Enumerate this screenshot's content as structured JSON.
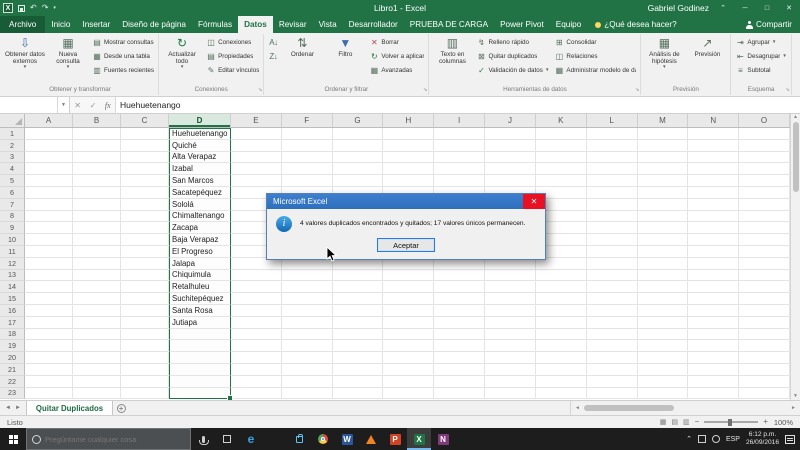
{
  "colors": {
    "excel_green": "#217346",
    "archivo_tab_green": "#185c37",
    "ribbon_bg": "#f1f1f1",
    "selection_green": "#217346",
    "dialog_title_blue": "#2d6fbd",
    "close_button_red": "#e81123",
    "info_icon_blue": "#1f87d4",
    "taskbar_dark": "#1d1d1d"
  },
  "title_bar": {
    "title": "Libro1 - Excel",
    "user_name": "Gabriel Godinez"
  },
  "ribbon": {
    "tabs": [
      "Archivo",
      "Inicio",
      "Insertar",
      "Diseño de página",
      "Fórmulas",
      "Datos",
      "Revisar",
      "Vista",
      "Desarrollador",
      "PRUEBA DE CARGA",
      "Power Pivot",
      "Equipo"
    ],
    "active_tab": "Datos",
    "tell_me": "¿Qué desea hacer?",
    "share_label": "Compartir",
    "groups": [
      {
        "label": "Obtener y transformar",
        "launcher": false,
        "buttons": [
          {
            "label": "Obtener datos externos",
            "type": "big",
            "icon": "external-data-icon",
            "dropdown": true
          },
          {
            "label": "Nueva consulta",
            "type": "big",
            "icon": "new-query-icon",
            "dropdown": true
          },
          {
            "label": "Mostrar consultas",
            "type": "small",
            "icon": "show-queries-icon",
            "dropdown": false
          },
          {
            "label": "Desde una tabla",
            "type": "small",
            "icon": "from-table-icon",
            "dropdown": false
          },
          {
            "label": "Fuentes recientes",
            "type": "small",
            "icon": "recent-sources-icon",
            "dropdown": false
          }
        ]
      },
      {
        "label": "Conexiones",
        "launcher": true,
        "buttons": [
          {
            "label": "Actualizar todo",
            "type": "big",
            "icon": "refresh-icon",
            "dropdown": true
          },
          {
            "label": "Conexiones",
            "type": "small",
            "icon": "connections-icon",
            "dropdown": false
          },
          {
            "label": "Propiedades",
            "type": "small",
            "icon": "properties-icon",
            "dropdown": false
          },
          {
            "label": "Editar vínculos",
            "type": "small",
            "icon": "edit-links-icon",
            "dropdown": false
          }
        ]
      },
      {
        "label": "Ordenar y filtrar",
        "launcher": true,
        "buttons": [
          {
            "label": "",
            "type": "small",
            "icon": "sort-az-icon",
            "dropdown": false
          },
          {
            "label": "",
            "type": "small",
            "icon": "sort-za-icon",
            "dropdown": false
          },
          {
            "label": "Ordenar",
            "type": "big",
            "icon": "sort-icon",
            "dropdown": false
          },
          {
            "label": "Filtro",
            "type": "big",
            "icon": "filter-icon",
            "dropdown": false
          },
          {
            "label": "Borrar",
            "type": "small",
            "icon": "clear-icon",
            "dropdown": false
          },
          {
            "label": "Volver a aplicar",
            "type": "small",
            "icon": "reapply-icon",
            "dropdown": false
          },
          {
            "label": "Avanzadas",
            "type": "small",
            "icon": "advanced-icon",
            "dropdown": false
          }
        ]
      },
      {
        "label": "Herramientas de datos",
        "launcher": true,
        "buttons": [
          {
            "label": "Texto en columnas",
            "type": "big",
            "icon": "text-to-columns-icon",
            "dropdown": false
          },
          {
            "label": "Relleno rápido",
            "type": "small",
            "icon": "flash-fill-icon",
            "dropdown": false
          },
          {
            "label": "Quitar duplicados",
            "type": "small",
            "icon": "remove-duplicates-icon",
            "dropdown": false
          },
          {
            "label": "Validación de datos",
            "type": "small",
            "icon": "data-validation-icon",
            "dropdown": true
          },
          {
            "label": "Consolidar",
            "type": "small",
            "icon": "consolidate-icon",
            "dropdown": false
          },
          {
            "label": "Relaciones",
            "type": "small",
            "icon": "relationships-icon",
            "dropdown": false
          },
          {
            "label": "Administrar modelo de datos",
            "type": "small",
            "icon": "data-model-icon",
            "dropdown": false
          }
        ]
      },
      {
        "label": "Previsión",
        "launcher": false,
        "buttons": [
          {
            "label": "Análisis de hipótesis",
            "type": "big",
            "icon": "what-if-icon",
            "dropdown": true
          },
          {
            "label": "Previsión",
            "type": "big",
            "icon": "forecast-icon",
            "dropdown": false
          }
        ]
      },
      {
        "label": "Esquema",
        "launcher": true,
        "buttons": [
          {
            "label": "Agrupar",
            "type": "small",
            "icon": "group-icon",
            "dropdown": true
          },
          {
            "label": "Desagrupar",
            "type": "small",
            "icon": "ungroup-icon",
            "dropdown": true
          },
          {
            "label": "Subtotal",
            "type": "small",
            "icon": "subtotal-icon",
            "dropdown": false
          }
        ]
      }
    ]
  },
  "formula_bar": {
    "name_box": "",
    "fx_label": "fx",
    "value": "Huehuetenango"
  },
  "grid": {
    "columns": [
      "A",
      "B",
      "C",
      "D",
      "E",
      "F",
      "G",
      "H",
      "I",
      "J",
      "K",
      "L",
      "M",
      "N",
      "O"
    ],
    "row_count": 23,
    "selected_column": "D",
    "data_column": "D",
    "values": [
      "Huehuetenango",
      "Quiché",
      "Alta Verapaz",
      "Izabal",
      "San Marcos",
      "Sacatepéquez",
      "Sololá",
      "Chimaltenango",
      "Zacapa",
      "Baja Verapaz",
      "El Progreso",
      "Jalapa",
      "Chiquimula",
      "Retalhuleu",
      "Suchitepéquez",
      "Santa Rosa",
      "Jutiapa"
    ]
  },
  "dialog": {
    "title": "Microsoft Excel",
    "message": "4 valores duplicados encontrados y quitados; 17 valores únicos permanecen.",
    "ok_label": "Aceptar"
  },
  "sheet_bar": {
    "active_tab": "Quitar Duplicados"
  },
  "status_bar": {
    "status": "Listo",
    "zoom": "100%"
  },
  "taskbar": {
    "search_placeholder": "Pregúntame cualquier cosa",
    "icons": [
      "mic-icon",
      "taskview-icon",
      "edge-icon",
      "explorer-icon",
      "store-icon",
      "chrome-icon",
      "word-icon",
      "vlc-icon",
      "powerpoint-icon",
      "excel-icon",
      "onenote-icon"
    ],
    "active_icon": "excel-icon",
    "tray": {
      "language": "ESP",
      "time": "6:12 p.m.",
      "date": "26/09/2016"
    }
  }
}
